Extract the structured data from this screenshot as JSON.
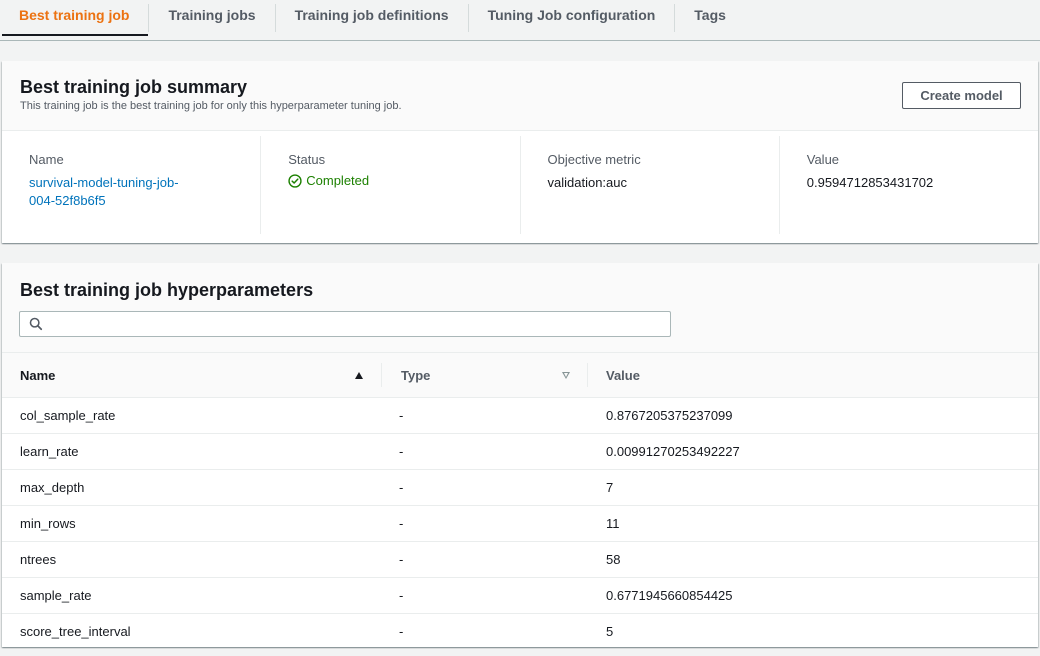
{
  "tabs": [
    {
      "label": "Best training job",
      "active": true
    },
    {
      "label": "Training jobs",
      "active": false
    },
    {
      "label": "Training job definitions",
      "active": false
    },
    {
      "label": "Tuning Job configuration",
      "active": false
    },
    {
      "label": "Tags",
      "active": false
    }
  ],
  "summary": {
    "title": "Best training job summary",
    "description": "This training job is the best training job for only this hyperparameter tuning job.",
    "create_model_label": "Create model",
    "name_label": "Name",
    "name_value": "survival-model-tuning-job-004-52f8b6f5",
    "status_label": "Status",
    "status_value": "Completed",
    "objective_label": "Objective metric",
    "objective_value": "validation:auc",
    "value_label": "Value",
    "value_value": "0.9594712853431702"
  },
  "hyperparameters": {
    "title": "Best training job hyperparameters",
    "search_placeholder": "",
    "columns": [
      "Name",
      "Type",
      "Value"
    ],
    "rows": [
      {
        "name": "col_sample_rate",
        "type": "-",
        "value": "0.8767205375237099"
      },
      {
        "name": "learn_rate",
        "type": "-",
        "value": "0.00991270253492227"
      },
      {
        "name": "max_depth",
        "type": "-",
        "value": "7"
      },
      {
        "name": "min_rows",
        "type": "-",
        "value": "11"
      },
      {
        "name": "ntrees",
        "type": "-",
        "value": "58"
      },
      {
        "name": "sample_rate",
        "type": "-",
        "value": "0.6771945660854425"
      },
      {
        "name": "score_tree_interval",
        "type": "-",
        "value": "5"
      }
    ]
  },
  "colors": {
    "accent": "#ec7211",
    "link": "#0073bb",
    "success": "#1d8102"
  },
  "icons": {
    "status": "check-circle-icon",
    "search": "search-icon",
    "sort_name": "sort-ascending-icon",
    "sort_type": "sort-none-icon"
  }
}
